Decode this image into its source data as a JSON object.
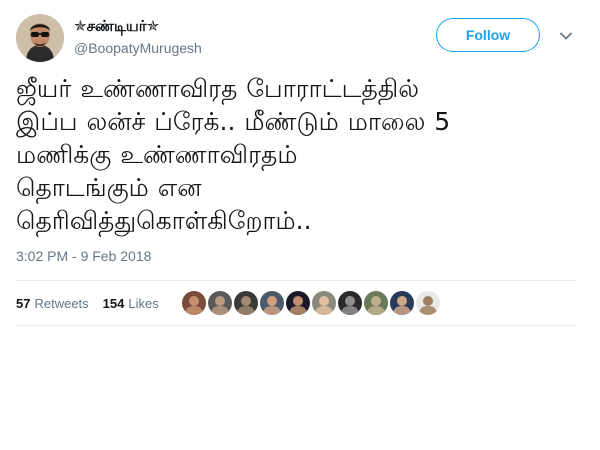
{
  "user": {
    "display_name": "✯சண்டியர்✯",
    "handle": "@BoopatyMurugesh"
  },
  "follow_label": "Follow",
  "tweet_text": "ஜீயர் உண்ணாவிரத போராட்டத்தில்\nஇப்ப லன்ச் ப்ரேக்.. மீண்டும் மாலை 5\nமணிக்கு உண்ணாவிரதம்\nதொடங்கும் என\nதெரிவித்துகொள்கிறோம்..",
  "timestamp": "3:02 PM - 9 Feb 2018",
  "stats": {
    "retweets": {
      "count": "57",
      "label": "Retweets"
    },
    "likes": {
      "count": "154",
      "label": "Likes"
    }
  },
  "colors": {
    "accent": "#1da1f2",
    "secondary_text": "#657786",
    "divider": "#e6ecf0"
  },
  "liker_avatars": [
    {
      "icon": "user-avatar-icon",
      "bg": "#7a4a3a",
      "fg": "#c89070"
    },
    {
      "icon": "user-avatar-icon",
      "bg": "#5a5a5a",
      "fg": "#b89a80"
    },
    {
      "icon": "user-avatar-icon",
      "bg": "#3a3a3a",
      "fg": "#a08a70"
    },
    {
      "icon": "user-avatar-icon",
      "bg": "#4a5a6a",
      "fg": "#d0a080"
    },
    {
      "icon": "user-avatar-icon",
      "bg": "#1a1a2a",
      "fg": "#c09070"
    },
    {
      "icon": "user-avatar-icon",
      "bg": "#8a8a7a",
      "fg": "#e0c0a0"
    },
    {
      "icon": "user-avatar-icon",
      "bg": "#2a2a2a",
      "fg": "#909090"
    },
    {
      "icon": "user-avatar-icon",
      "bg": "#6a7a5a",
      "fg": "#c0b090"
    },
    {
      "icon": "user-avatar-icon",
      "bg": "#2a3a5a",
      "fg": "#d0a888"
    },
    {
      "icon": "user-avatar-icon",
      "bg": "#e8e8e8",
      "fg": "#a08060"
    }
  ]
}
